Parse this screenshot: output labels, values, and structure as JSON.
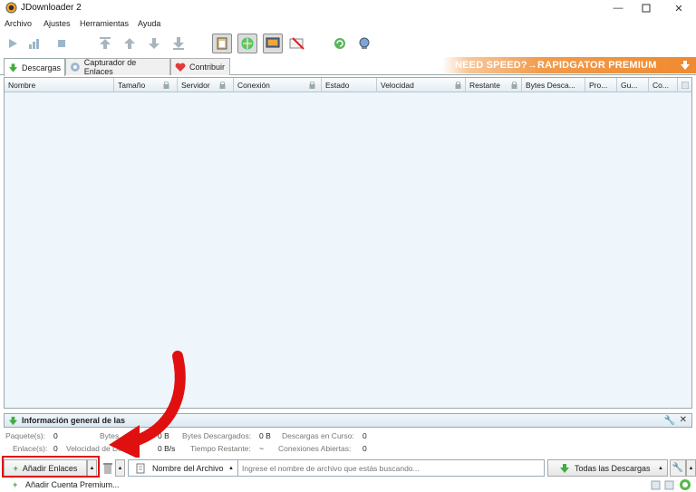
{
  "window": {
    "title": "JDownloader 2",
    "controls": [
      "minimize",
      "maximize",
      "close"
    ]
  },
  "menu": [
    "Archivo",
    "Ajustes",
    "Herramientas",
    "Ayuda"
  ],
  "tabs": [
    {
      "label": "Descargas",
      "icon": "download-arrow-icon",
      "active": true
    },
    {
      "label": "Capturador de Enlaces",
      "icon": "link-grabber-icon",
      "active": false
    },
    {
      "label": "Contribuir",
      "icon": "heart-icon",
      "active": false
    }
  ],
  "promo": {
    "text": "NEED SPEED?→RAPIDGATOR PREMIUM"
  },
  "table": {
    "columns": [
      "Nombre",
      "Tamaño",
      "Servidor",
      "Conexión",
      "Estado",
      "Velocidad",
      "Restante",
      "Bytes Desca...",
      "Pro...",
      "Gu...",
      "Co..."
    ]
  },
  "info": {
    "title": "Información general de las",
    "labels": {
      "paquetes": "Paquete(s):",
      "enlaces": "Enlace(s):",
      "bytes_total": "Bytes",
      "velocidad": "Velocidad de De",
      "bytes_descargados": "Bytes Descargados:",
      "tiempo_restante": "Tiempo Restante:",
      "descargas_curso": "Descargas en Curso:",
      "conexiones": "Conexiones Abiertas:"
    },
    "values": {
      "paquetes": "0",
      "enlaces": "0",
      "bytes_total": "0 B",
      "velocidad": "0 B/s",
      "bytes_descargados": "0 B",
      "tiempo_restante": "~",
      "descargas_curso": "0",
      "conexiones": "0"
    }
  },
  "bottom": {
    "add_links": "Añadir Enlaces",
    "search_field": "Nombre del Archivo",
    "search_placeholder": "Ingrese el nombre de archivo que estás buscando...",
    "downloads_filter": "Todas las Descargas"
  },
  "status": {
    "add_premium": "Añadir Cuenta Premium..."
  },
  "colors": {
    "highlight": "#e01010",
    "promo": "#ef8a30",
    "table_bg": "#eef6fb"
  }
}
